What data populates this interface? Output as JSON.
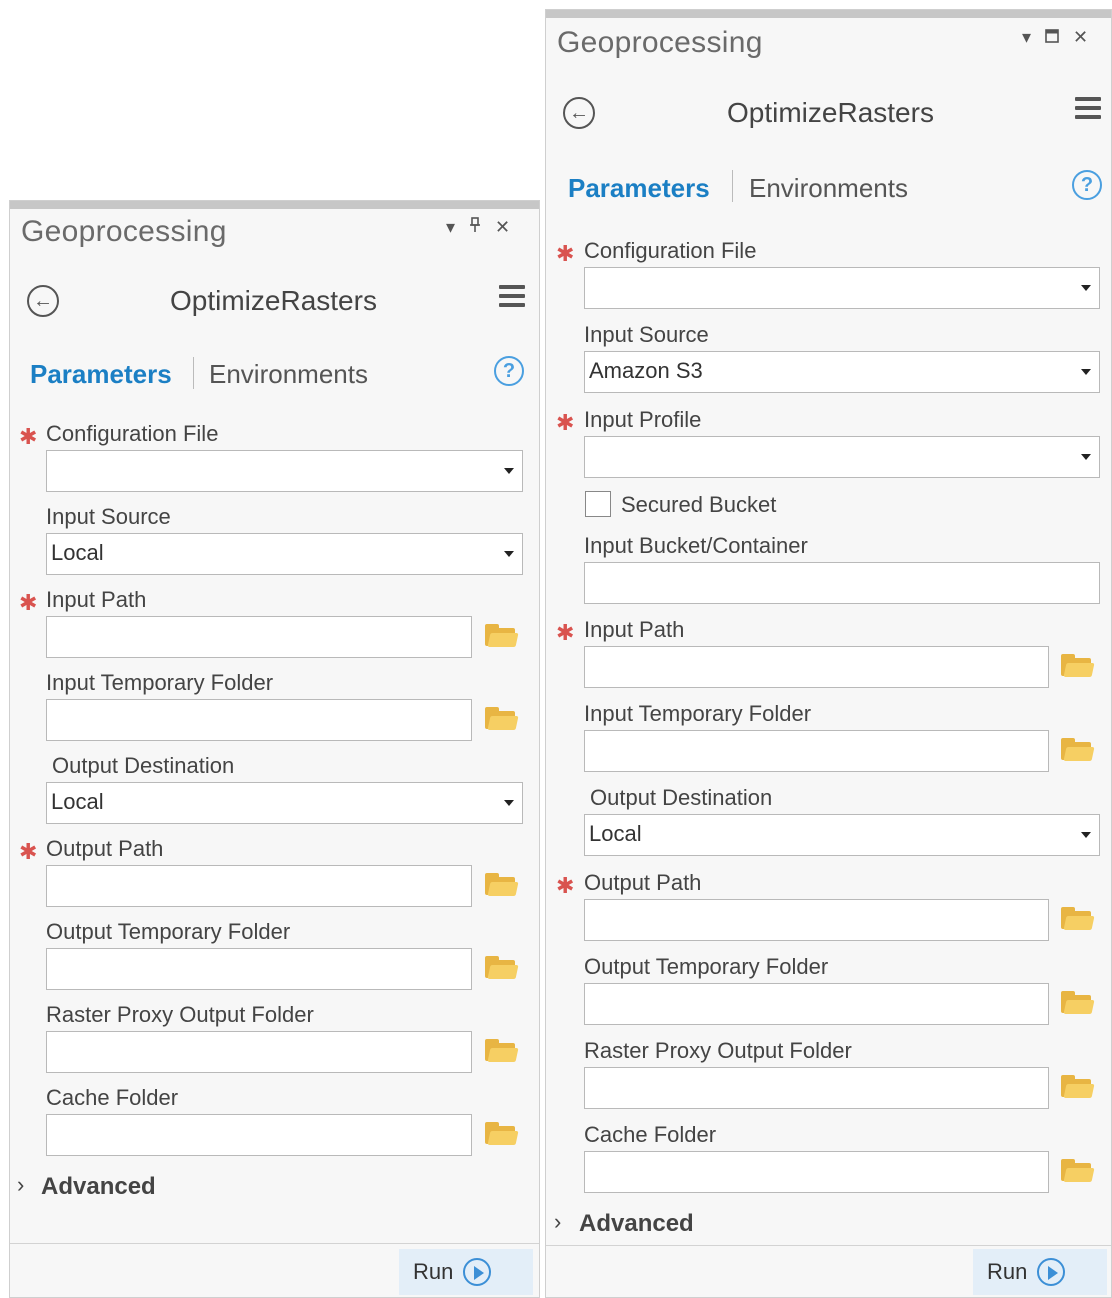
{
  "panes": [
    {
      "title": "Geoprocessing",
      "controls": [
        "▾",
        "pin",
        "✕"
      ],
      "tool_title": "OptimizeRasters",
      "tabs": {
        "active": "Parameters",
        "inactive": "Environments"
      },
      "help_symbol": "?",
      "fields": [
        {
          "label": "Configuration File",
          "required": true,
          "type": "dropdown",
          "value": ""
        },
        {
          "label": "Input Source",
          "required": false,
          "type": "dropdown",
          "value": "Local"
        },
        {
          "label": "Input Path",
          "required": true,
          "type": "folder",
          "value": ""
        },
        {
          "label": "Input Temporary Folder",
          "required": false,
          "type": "folder",
          "value": ""
        },
        {
          "label": "Output Destination",
          "required": false,
          "type": "dropdown",
          "value": "Local"
        },
        {
          "label": "Output Path",
          "required": true,
          "type": "folder",
          "value": ""
        },
        {
          "label": "Output Temporary Folder",
          "required": false,
          "type": "folder",
          "value": ""
        },
        {
          "label": "Raster Proxy Output Folder",
          "required": false,
          "type": "folder",
          "value": ""
        },
        {
          "label": "Cache Folder",
          "required": false,
          "type": "folder",
          "value": ""
        }
      ],
      "advanced_label": "Advanced",
      "run_label": "Run"
    },
    {
      "title": "Geoprocessing",
      "controls": [
        "▾",
        "maximize",
        "✕"
      ],
      "tool_title": "OptimizeRasters",
      "tabs": {
        "active": "Parameters",
        "inactive": "Environments"
      },
      "help_symbol": "?",
      "fields": [
        {
          "label": "Configuration File",
          "required": true,
          "type": "dropdown",
          "value": ""
        },
        {
          "label": "Input Source",
          "required": false,
          "type": "dropdown",
          "value": "Amazon S3"
        },
        {
          "label": "Input Profile",
          "required": true,
          "type": "dropdown",
          "value": ""
        },
        {
          "label": "Secured Bucket",
          "required": false,
          "type": "checkbox",
          "checked": false
        },
        {
          "label": "Input Bucket/Container",
          "required": false,
          "type": "text",
          "value": ""
        },
        {
          "label": "Input Path",
          "required": true,
          "type": "folder",
          "value": ""
        },
        {
          "label": "Input Temporary Folder",
          "required": false,
          "type": "folder",
          "value": ""
        },
        {
          "label": "Output Destination",
          "required": false,
          "type": "dropdown",
          "value": "Local"
        },
        {
          "label": "Output Path",
          "required": true,
          "type": "folder",
          "value": ""
        },
        {
          "label": "Output Temporary Folder",
          "required": false,
          "type": "folder",
          "value": ""
        },
        {
          "label": "Raster Proxy Output Folder",
          "required": false,
          "type": "folder",
          "value": ""
        },
        {
          "label": "Cache Folder",
          "required": false,
          "type": "folder",
          "value": ""
        }
      ],
      "advanced_label": "Advanced",
      "run_label": "Run"
    }
  ],
  "icons": {
    "required": "✱",
    "back": "←",
    "expand": "›",
    "dropdown": "▾",
    "close": "✕"
  },
  "colors": {
    "accent": "#1b7fc4",
    "required": "#d9534f",
    "folder": "#e8b543",
    "run_button": "#e3eef8"
  }
}
